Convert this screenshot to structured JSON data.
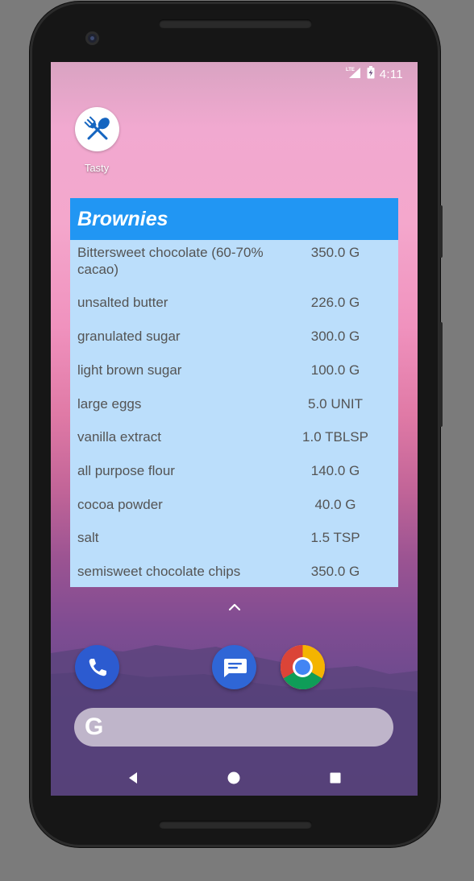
{
  "status_bar": {
    "network": "LTE",
    "time": "4:11"
  },
  "home": {
    "app_label": "Tasty"
  },
  "widget": {
    "title": "Brownies",
    "ingredients": [
      {
        "name": "Bittersweet chocolate (60-70% cacao)",
        "qty": "350.0 G"
      },
      {
        "name": "unsalted butter",
        "qty": "226.0 G"
      },
      {
        "name": "granulated sugar",
        "qty": "300.0 G"
      },
      {
        "name": "light brown sugar",
        "qty": "100.0 G"
      },
      {
        "name": "large eggs",
        "qty": "5.0 UNIT"
      },
      {
        "name": "vanilla extract",
        "qty": "1.0 TBLSP"
      },
      {
        "name": "all purpose flour",
        "qty": "140.0 G"
      },
      {
        "name": "cocoa powder",
        "qty": "40.0 G"
      },
      {
        "name": "salt",
        "qty": "1.5 TSP"
      },
      {
        "name": "semisweet chocolate chips",
        "qty": "350.0 G"
      }
    ]
  },
  "dock": {
    "apps": [
      "phone-icon",
      "messages-icon",
      "chrome-icon"
    ]
  },
  "search": {
    "logo": "G"
  },
  "colors": {
    "widget_header": "#2196f3",
    "widget_body": "#bbdefb",
    "ingredient_text": "#545454"
  }
}
